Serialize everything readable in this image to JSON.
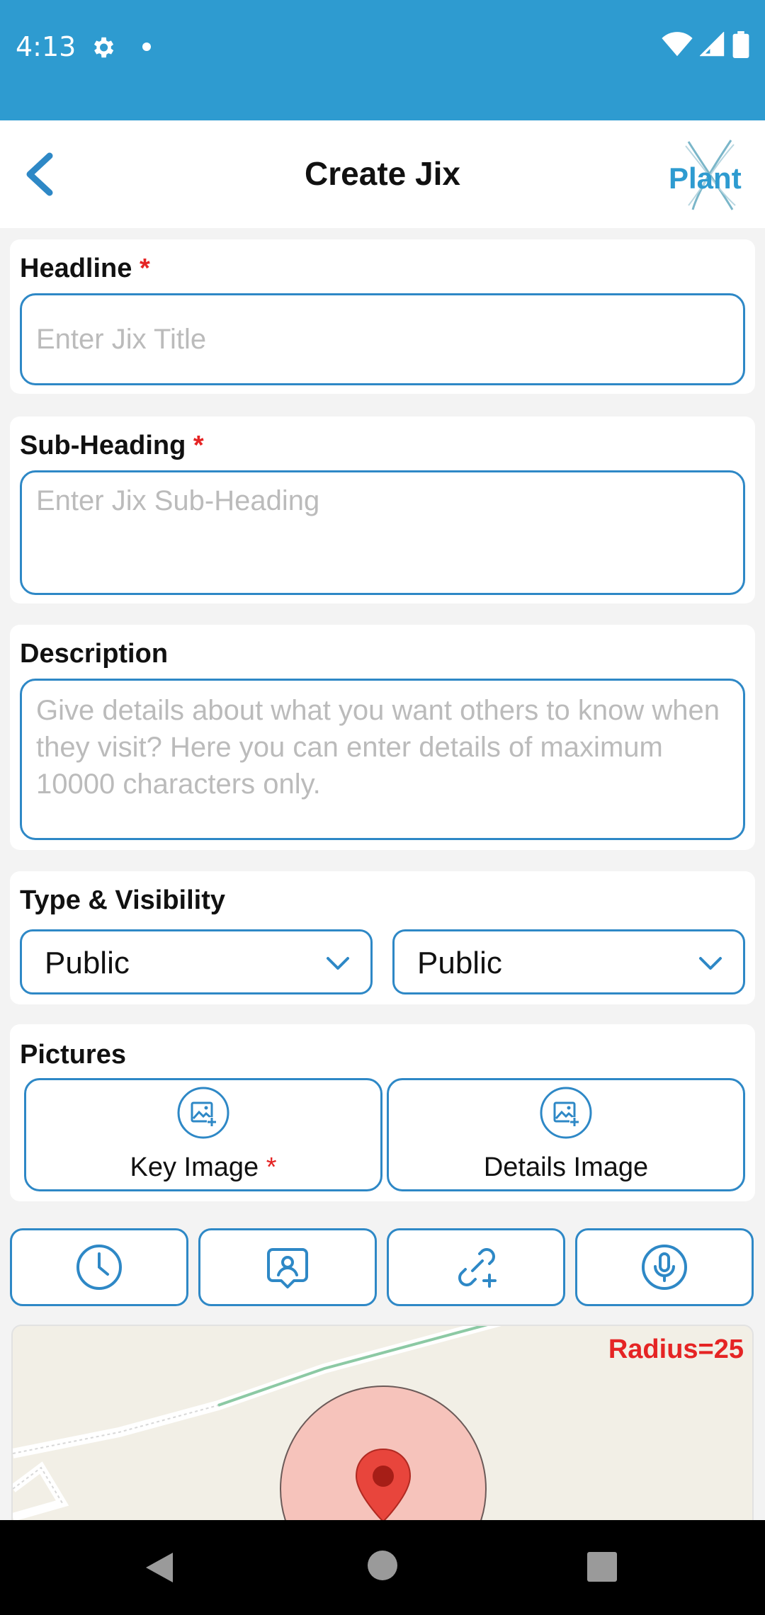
{
  "status_bar": {
    "time": "4:13"
  },
  "header": {
    "title": "Create Jix",
    "logo_text": "Plant"
  },
  "headline": {
    "label": "Headline",
    "required_mark": "*",
    "placeholder": "Enter Jix Title"
  },
  "subheading": {
    "label": "Sub-Heading",
    "required_mark": "*",
    "placeholder": "Enter Jix Sub-Heading"
  },
  "description": {
    "label": "Description",
    "placeholder": "Give details about what you want others to know when they visit? Here you can enter details of maximum 10000 characters only."
  },
  "type_visibility": {
    "label": "Type & Visibility",
    "type_value": "Public",
    "visibility_value": "Public"
  },
  "pictures": {
    "label": "Pictures",
    "key_image_label": "Key Image",
    "required_mark": "*",
    "details_image_label": "Details Image"
  },
  "tools": [
    "clock-icon",
    "contact-icon",
    "link-add-icon",
    "microphone-icon"
  ],
  "map": {
    "radius_label": "Radius=25",
    "accent_color": "#e52424"
  },
  "colors": {
    "brand": "#2e9bd0",
    "border": "#2e88c6",
    "required": "#e52424"
  }
}
